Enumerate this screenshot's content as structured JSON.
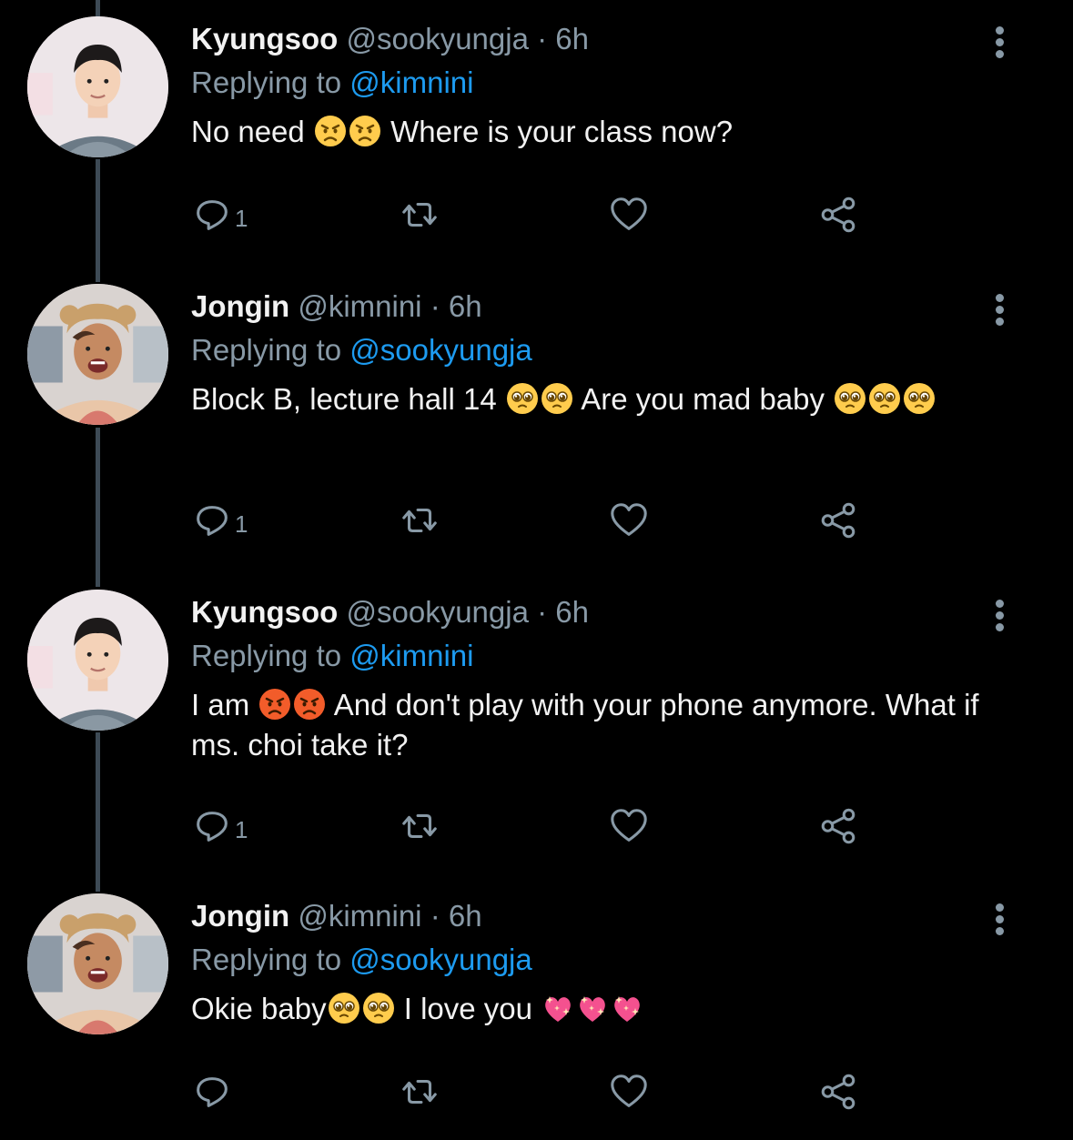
{
  "tweets": [
    {
      "name": "Kyungsoo",
      "handle": "@sookyungja",
      "separator": "·",
      "time": "6h",
      "replying_label": "Replying to",
      "replying_to": "@kimnini",
      "body_parts": [
        "No need ",
        "angry",
        "angry",
        " Where is your class now?"
      ],
      "reply_count": "1",
      "avatar": "kyungsoo-avatar"
    },
    {
      "name": "Jongin",
      "handle": "@kimnini",
      "separator": "·",
      "time": "6h",
      "replying_label": "Replying to",
      "replying_to": "@sookyungja",
      "body_parts": [
        "Block B, lecture hall 14 ",
        "pleading",
        "pleading",
        " Are you mad baby ",
        "pleading",
        "pleading",
        "pleading"
      ],
      "reply_count": "1",
      "avatar": "jongin-avatar"
    },
    {
      "name": "Kyungsoo",
      "handle": "@sookyungja",
      "separator": "·",
      "time": "6h",
      "replying_label": "Replying to",
      "replying_to": "@kimnini",
      "body_parts": [
        "I am ",
        "pouting",
        "pouting",
        " And don't play with your phone anymore. What if ms. choi take it?"
      ],
      "reply_count": "1",
      "avatar": "kyungsoo-avatar"
    },
    {
      "name": "Jongin",
      "handle": "@kimnini",
      "separator": "·",
      "time": "6h",
      "replying_label": "Replying to",
      "replying_to": "@sookyungja",
      "body_parts": [
        "Okie baby",
        "pleading",
        "pleading",
        " I love you ",
        "sparkling-heart",
        "sparkling-heart",
        "sparkling-heart"
      ],
      "reply_count": "",
      "avatar": "jongin-avatar"
    }
  ],
  "icons": {
    "reply": "reply-icon",
    "retweet": "retweet-icon",
    "like": "heart-icon",
    "share": "share-icon",
    "more": "more-options-icon"
  },
  "colors": {
    "background": "#000000",
    "text": "#f2f2f2",
    "muted": "#8899a6",
    "mention": "#1d9bf0",
    "thread_line": "#3d4a55"
  }
}
